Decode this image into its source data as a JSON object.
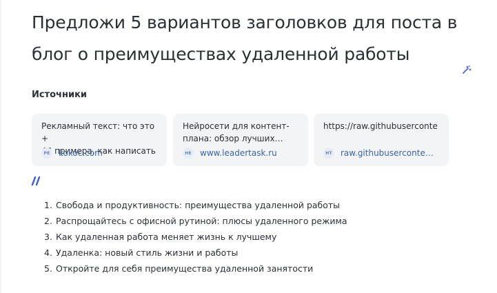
{
  "question": {
    "line1": "Предложи 5 вариантов заголовков для поста в",
    "line2": "блог о преимуществах удаленной работы"
  },
  "sources": {
    "title": "Источники",
    "items": [
      {
        "title": "Рекламный текст: что это +\n44 примера, как написать",
        "favicon": "PE",
        "domain": "kokoc.com"
      },
      {
        "title": "Нейросети для контент-\nплана: обзор лучших…",
        "favicon": "HE",
        "domain": "www.leadertask.ru"
      },
      {
        "title": "https://raw.githubuserconte",
        "favicon": "HT",
        "domain": "raw.githubuserconte…"
      }
    ]
  },
  "answer": {
    "items": [
      {
        "num": "1.",
        "text": "Свобода и продуктивность: преимущества удаленной работы"
      },
      {
        "num": "2.",
        "text": "Распрощайтесь с офисной рутиной: плюсы удаленного режима"
      },
      {
        "num": "3.",
        "text": "Как удаленная работа меняет жизнь к лучшему"
      },
      {
        "num": "4.",
        "text": "Удаленка: новый стиль жизни и работы"
      },
      {
        "num": "5.",
        "text": "Откройте для себя преимущества удаленной занятости"
      }
    ]
  },
  "icons": {
    "edit": "magic-wand-edit-icon",
    "assistant": "ai-logo-icon"
  },
  "colors": {
    "link": "#3a62a8",
    "accent": "#3d5bd9",
    "card_bg": "#f3f4f6"
  }
}
